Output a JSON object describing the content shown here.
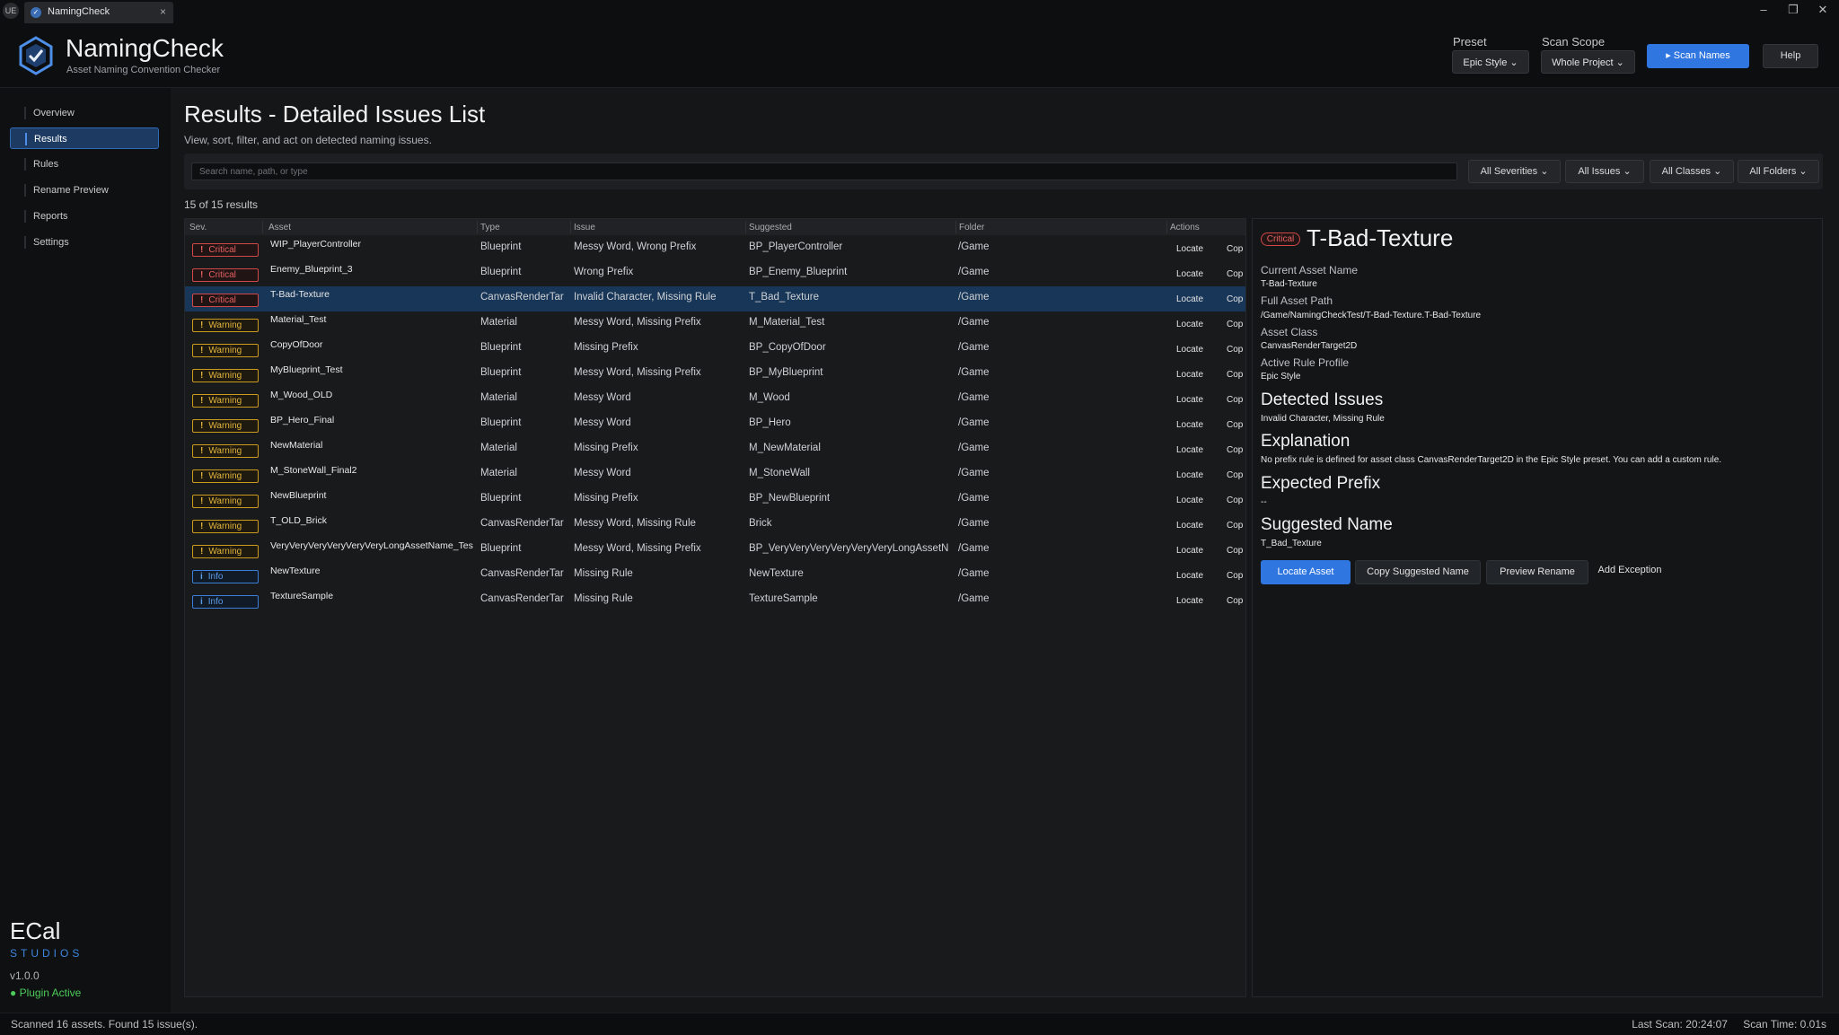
{
  "window": {
    "engine_logo": "UE",
    "tab_label": "NamingCheck",
    "tab_close": "×",
    "minimize": "–",
    "restore": "❐",
    "close": "✕"
  },
  "header": {
    "title": "NamingCheck",
    "subtitle": "Asset Naming Convention Checker",
    "preset_label": "Preset",
    "preset_value": "Epic Style ⌄",
    "scope_label": "Scan Scope",
    "scope_value": "Whole Project ⌄",
    "scan_button": "▸ Scan Names",
    "help_button": "Help"
  },
  "sidebar": {
    "items": [
      {
        "label": "Overview"
      },
      {
        "label": "Results",
        "active": true
      },
      {
        "label": "Rules"
      },
      {
        "label": "Rename Preview"
      },
      {
        "label": "Reports"
      },
      {
        "label": "Settings"
      }
    ],
    "brand_name": "ECal",
    "brand_sub": "STUDIOS",
    "version": "v1.0.0",
    "plugin_status": "● Plugin Active"
  },
  "main": {
    "title": "Results - Detailed Issues List",
    "subtitle": "View, sort, filter, and act on detected naming issues.",
    "search_placeholder": "Search name, path, or type",
    "filters": [
      "All Severities ⌄",
      "All Issues ⌄",
      "All Classes ⌄",
      "All Folders ⌄"
    ],
    "result_count": "15 of 15 results"
  },
  "table": {
    "columns": [
      "Sev.",
      "Asset",
      "Type",
      "Issue",
      "Suggested",
      "Folder",
      "Actions"
    ],
    "locate_label": "Locate",
    "copy_label": "Cop",
    "rows": [
      {
        "sev": "Critical",
        "icon": "!",
        "asset": "WIP_PlayerController",
        "type": "Blueprint",
        "issue": "Messy Word, Wrong Prefix",
        "suggested": "BP_PlayerController",
        "folder": "/Game"
      },
      {
        "sev": "Critical",
        "icon": "!",
        "asset": "Enemy_Blueprint_3",
        "type": "Blueprint",
        "issue": "Wrong Prefix",
        "suggested": "BP_Enemy_Blueprint",
        "folder": "/Game"
      },
      {
        "sev": "Critical",
        "icon": "!",
        "asset": "T-Bad-Texture",
        "type": "CanvasRenderTar",
        "issue": "Invalid Character, Missing Rule",
        "suggested": "T_Bad_Texture",
        "folder": "/Game",
        "selected": true
      },
      {
        "sev": "Warning",
        "icon": "!",
        "asset": "Material_Test",
        "type": "Material",
        "issue": "Messy Word, Missing Prefix",
        "suggested": "M_Material_Test",
        "folder": "/Game"
      },
      {
        "sev": "Warning",
        "icon": "!",
        "asset": "CopyOfDoor",
        "type": "Blueprint",
        "issue": "Missing Prefix",
        "suggested": "BP_CopyOfDoor",
        "folder": "/Game"
      },
      {
        "sev": "Warning",
        "icon": "!",
        "asset": "MyBlueprint_Test",
        "type": "Blueprint",
        "issue": "Messy Word, Missing Prefix",
        "suggested": "BP_MyBlueprint",
        "folder": "/Game"
      },
      {
        "sev": "Warning",
        "icon": "!",
        "asset": "M_Wood_OLD",
        "type": "Material",
        "issue": "Messy Word",
        "suggested": "M_Wood",
        "folder": "/Game"
      },
      {
        "sev": "Warning",
        "icon": "!",
        "asset": "BP_Hero_Final",
        "type": "Blueprint",
        "issue": "Messy Word",
        "suggested": "BP_Hero",
        "folder": "/Game"
      },
      {
        "sev": "Warning",
        "icon": "!",
        "asset": "NewMaterial",
        "type": "Material",
        "issue": "Missing Prefix",
        "suggested": "M_NewMaterial",
        "folder": "/Game"
      },
      {
        "sev": "Warning",
        "icon": "!",
        "asset": "M_StoneWall_Final2",
        "type": "Material",
        "issue": "Messy Word",
        "suggested": "M_StoneWall",
        "folder": "/Game"
      },
      {
        "sev": "Warning",
        "icon": "!",
        "asset": "NewBlueprint",
        "type": "Blueprint",
        "issue": "Missing Prefix",
        "suggested": "BP_NewBlueprint",
        "folder": "/Game"
      },
      {
        "sev": "Warning",
        "icon": "!",
        "asset": "T_OLD_Brick",
        "type": "CanvasRenderTar",
        "issue": "Messy Word, Missing Rule",
        "suggested": "Brick",
        "folder": "/Game"
      },
      {
        "sev": "Warning",
        "icon": "!",
        "asset": "VeryVeryVeryVeryVeryVeryLongAssetName_Tes",
        "type": "Blueprint",
        "issue": "Messy Word, Missing Prefix",
        "suggested": "BP_VeryVeryVeryVeryVeryVeryLongAssetN",
        "folder": "/Game"
      },
      {
        "sev": "Info",
        "icon": "i",
        "asset": "NewTexture",
        "type": "CanvasRenderTar",
        "issue": "Missing Rule",
        "suggested": "NewTexture",
        "folder": "/Game"
      },
      {
        "sev": "Info",
        "icon": "i",
        "asset": "TextureSample",
        "type": "CanvasRenderTar",
        "issue": "Missing Rule",
        "suggested": "TextureSample",
        "folder": "/Game"
      }
    ]
  },
  "details": {
    "badge": "Critical",
    "title": "T-Bad-Texture",
    "current_name_label": "Current Asset Name",
    "current_name": "T-Bad-Texture",
    "path_label": "Full Asset Path",
    "path": "/Game/NamingCheckTest/T-Bad-Texture.T-Bad-Texture",
    "class_label": "Asset Class",
    "class": "CanvasRenderTarget2D",
    "profile_label": "Active Rule Profile",
    "profile": "Epic Style",
    "issues_heading": "Detected Issues",
    "issues": "Invalid Character, Missing Rule",
    "explanation_heading": "Explanation",
    "explanation": "No prefix rule is defined for asset class CanvasRenderTarget2D in the Epic Style preset. You can add a custom rule.",
    "prefix_heading": "Expected Prefix",
    "prefix": "--",
    "suggested_heading": "Suggested Name",
    "suggested": "T_Bad_Texture",
    "btn_locate": "Locate Asset",
    "btn_copy": "Copy Suggested Name",
    "btn_preview": "Preview Rename",
    "btn_exception": "Add Exception"
  },
  "status": {
    "left": "Scanned 16 assets. Found 15 issue(s).",
    "last_scan": "Last Scan: 20:24:07",
    "scan_time": "Scan Time: 0.01s"
  },
  "colors": {
    "accent": "#2f76e0",
    "critical": "#e86060",
    "warning": "#e2b43a",
    "info": "#5b9ce8",
    "active_green": "#4ccb59"
  }
}
